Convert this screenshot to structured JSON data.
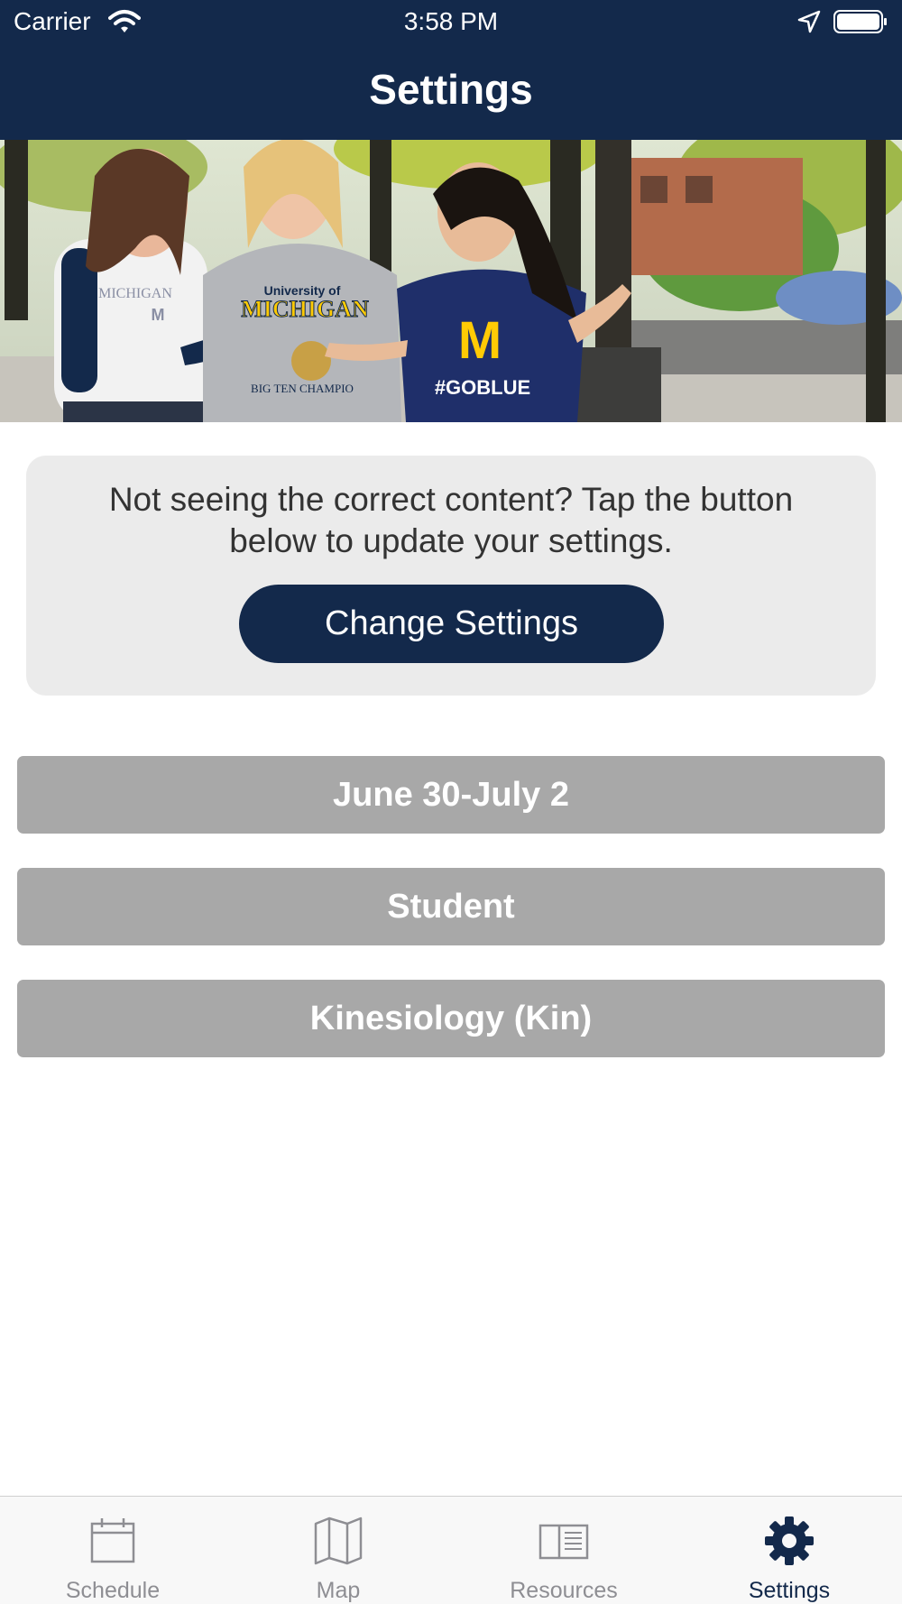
{
  "status_bar": {
    "carrier": "Carrier",
    "time": "3:58 PM"
  },
  "nav": {
    "title": "Settings"
  },
  "hero": {
    "shirt_text_1": "University of",
    "shirt_text_2": "MICHIGAN",
    "shirt_text_3": "BIG TEN CHAMPIO",
    "shirt_text_4": "M",
    "shirt_text_5": "#GOBLUE"
  },
  "card": {
    "message": "Not seeing the correct content? Tap the button below to update your settings.",
    "button_label": "Change Settings"
  },
  "settings": [
    {
      "label": "June 30-July 2"
    },
    {
      "label": "Student"
    },
    {
      "label": "Kinesiology (Kin)"
    }
  ],
  "tabs": [
    {
      "label": "Schedule",
      "icon": "calendar-icon",
      "active": false
    },
    {
      "label": "Map",
      "icon": "map-icon",
      "active": false
    },
    {
      "label": "Resources",
      "icon": "book-icon",
      "active": false
    },
    {
      "label": "Settings",
      "icon": "gear-icon",
      "active": true
    }
  ],
  "colors": {
    "brand_navy": "#13294b",
    "maize": "#ffcb05",
    "setting_gray": "#a8a8a8",
    "card_bg": "#ebebeb",
    "tab_inactive": "#8e8e93"
  }
}
